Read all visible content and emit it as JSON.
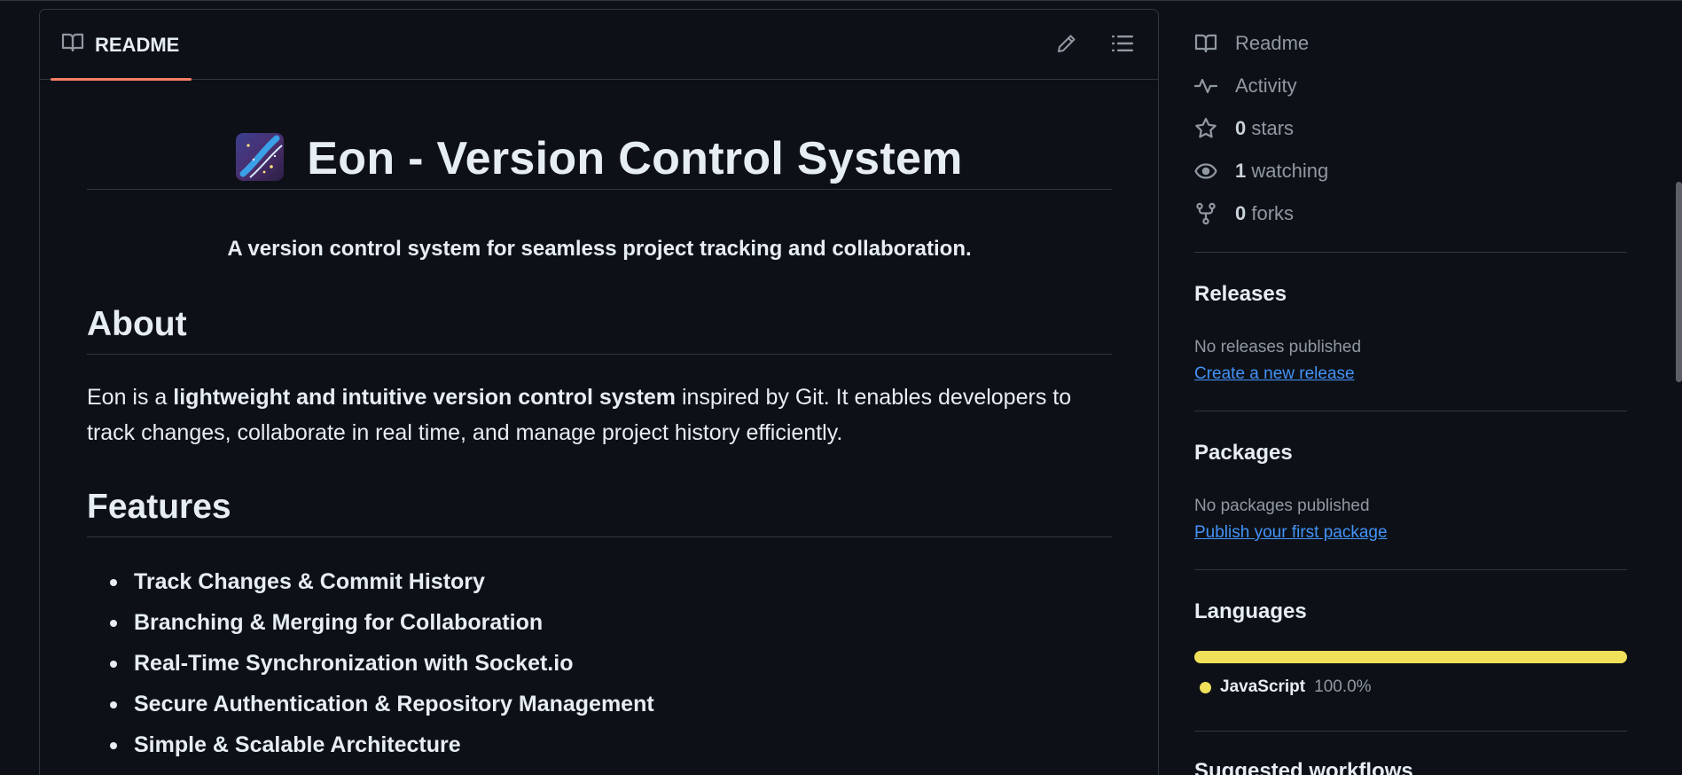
{
  "readme": {
    "tab_label": "README",
    "title": "Eon - Version Control System",
    "tagline": "A version control system for seamless project tracking and collaboration.",
    "about": {
      "heading": "About",
      "text_prefix": "Eon is a ",
      "text_bold": "lightweight and intuitive version control system",
      "text_suffix": " inspired by Git. It enables developers to track changes, collaborate in real time, and manage project history efficiently."
    },
    "features": {
      "heading": "Features",
      "items": [
        "Track Changes & Commit History",
        "Branching & Merging for Collaboration",
        "Real-Time Synchronization with Socket.io",
        "Secure Authentication & Repository Management",
        "Simple & Scalable Architecture"
      ]
    }
  },
  "sidebar": {
    "meta": {
      "readme": "Readme",
      "activity": "Activity",
      "stars_count": "0",
      "stars_label": "stars",
      "watching_count": "1",
      "watching_label": "watching",
      "forks_count": "0",
      "forks_label": "forks"
    },
    "releases": {
      "heading": "Releases",
      "empty": "No releases published",
      "link": "Create a new release"
    },
    "packages": {
      "heading": "Packages",
      "empty": "No packages published",
      "link": "Publish your first package"
    },
    "languages": {
      "heading": "Languages",
      "items": [
        {
          "name": "JavaScript",
          "percent": "100.0%",
          "color": "#f1e05a"
        }
      ]
    },
    "suggested_workflows": {
      "heading": "Suggested workflows"
    }
  },
  "colors": {
    "background": "#0d1117",
    "border": "#30363d",
    "tab_underline": "#f78166",
    "link": "#4493f8",
    "muted": "#9198a1"
  }
}
